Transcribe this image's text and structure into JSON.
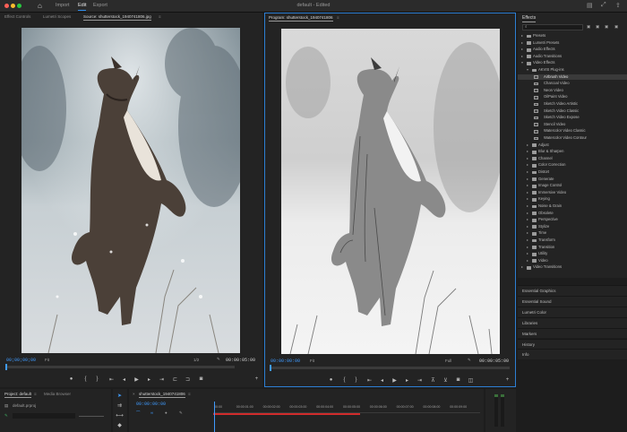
{
  "window": {
    "title": "default - Edited",
    "home_icon": "home-icon",
    "menu": [
      "Import",
      "Edit",
      "Export"
    ],
    "active_menu": "Edit"
  },
  "source_monitor": {
    "tabs": [
      "Effect Controls",
      "Lumetri Scopes",
      "Source: shutterstock_1940741806.jpg"
    ],
    "active_tab": "Source: shutterstock_1940741806.jpg",
    "timecode": "00;00;00;00",
    "fit": "Fit",
    "resolution": "1/2",
    "duration": "00:00:05:00"
  },
  "program_monitor": {
    "tab": "Program: shutterstock_1940741806",
    "timecode": "00:00:00:00",
    "fit": "Fit",
    "resolution": "Full",
    "duration": "00:00:05:00"
  },
  "effects": {
    "title": "Effects",
    "tree": [
      {
        "label": "Presets",
        "depth": 0,
        "kind": "folder",
        "open": false
      },
      {
        "label": "Lumetri Presets",
        "depth": 0,
        "kind": "folder",
        "open": false
      },
      {
        "label": "Audio Effects",
        "depth": 0,
        "kind": "folder",
        "open": false
      },
      {
        "label": "Audio Transitions",
        "depth": 0,
        "kind": "folder",
        "open": false
      },
      {
        "label": "Video Effects",
        "depth": 0,
        "kind": "folder",
        "open": true
      },
      {
        "label": "AKVIS Plug-ins",
        "depth": 1,
        "kind": "folder",
        "open": true
      },
      {
        "label": "Airbrush Video",
        "depth": 2,
        "kind": "fx",
        "selected": true
      },
      {
        "label": "Charcoal Video",
        "depth": 2,
        "kind": "fx"
      },
      {
        "label": "Neon Video",
        "depth": 2,
        "kind": "fx"
      },
      {
        "label": "OilPaint Video",
        "depth": 2,
        "kind": "fx"
      },
      {
        "label": "Sketch Video Artistic",
        "depth": 2,
        "kind": "fx"
      },
      {
        "label": "Sketch Video Classic",
        "depth": 2,
        "kind": "fx"
      },
      {
        "label": "Sketch Video Expose",
        "depth": 2,
        "kind": "fx"
      },
      {
        "label": "Stencil Video",
        "depth": 2,
        "kind": "fx"
      },
      {
        "label": "Watercolor Video Classic",
        "depth": 2,
        "kind": "fx"
      },
      {
        "label": "Watercolor Video Contour",
        "depth": 2,
        "kind": "fx"
      },
      {
        "label": "Adjust",
        "depth": 1,
        "kind": "folder",
        "open": false
      },
      {
        "label": "Blur & Sharpen",
        "depth": 1,
        "kind": "folder",
        "open": false
      },
      {
        "label": "Channel",
        "depth": 1,
        "kind": "folder",
        "open": false
      },
      {
        "label": "Color Correction",
        "depth": 1,
        "kind": "folder",
        "open": false
      },
      {
        "label": "Distort",
        "depth": 1,
        "kind": "folder",
        "open": false
      },
      {
        "label": "Generate",
        "depth": 1,
        "kind": "folder",
        "open": false
      },
      {
        "label": "Image Control",
        "depth": 1,
        "kind": "folder",
        "open": false
      },
      {
        "label": "Immersive Video",
        "depth": 1,
        "kind": "folder",
        "open": false
      },
      {
        "label": "Keying",
        "depth": 1,
        "kind": "folder",
        "open": false
      },
      {
        "label": "Noise & Grain",
        "depth": 1,
        "kind": "folder",
        "open": false
      },
      {
        "label": "Obsolete",
        "depth": 1,
        "kind": "folder",
        "open": false
      },
      {
        "label": "Perspective",
        "depth": 1,
        "kind": "folder",
        "open": false
      },
      {
        "label": "Stylize",
        "depth": 1,
        "kind": "folder",
        "open": false
      },
      {
        "label": "Time",
        "depth": 1,
        "kind": "folder",
        "open": false
      },
      {
        "label": "Transform",
        "depth": 1,
        "kind": "folder",
        "open": false
      },
      {
        "label": "Transition",
        "depth": 1,
        "kind": "folder",
        "open": false
      },
      {
        "label": "Utility",
        "depth": 1,
        "kind": "folder",
        "open": false
      },
      {
        "label": "Video",
        "depth": 1,
        "kind": "folder",
        "open": false
      },
      {
        "label": "Video Transitions",
        "depth": 0,
        "kind": "folder",
        "open": false
      }
    ],
    "sections": [
      "Essential Graphics",
      "Essential Sound",
      "Lumetri Color",
      "Libraries",
      "Markers",
      "History",
      "Info"
    ]
  },
  "project": {
    "tabs": [
      "Project: default",
      "Media Browser"
    ],
    "active_tab": "Project: default",
    "file": "default.prproj"
  },
  "timeline": {
    "tab": "shutterstock_1940741806",
    "timecode": "00:00:00:00",
    "ruler": [
      "00:00",
      "00:00:01:00",
      "00:00:02:00",
      "00:00:03:00",
      "00:00:04:00",
      "00:00:05:00",
      "00:00:06:00",
      "00:00:07:00",
      "00:00:08:00",
      "00:00:09:00"
    ]
  },
  "colors": {
    "accent": "#3f9bff",
    "playhead": "#3f9bff",
    "render_bar": "#d02b2b"
  }
}
